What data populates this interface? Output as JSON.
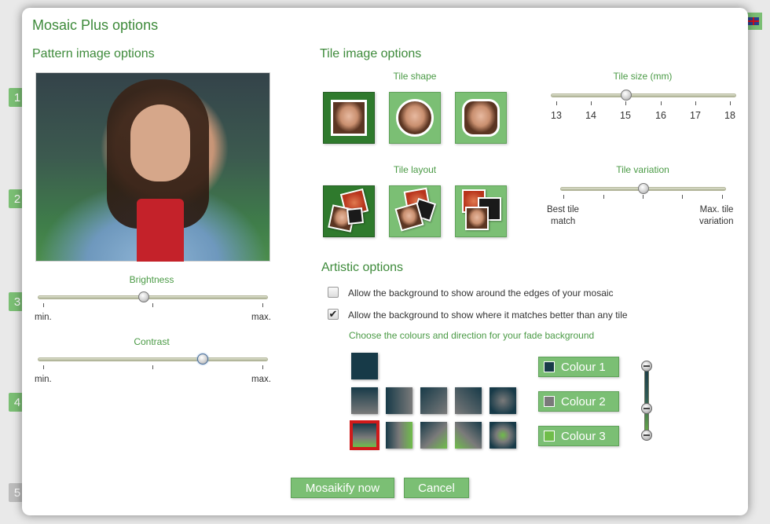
{
  "background": {
    "steps": [
      "1",
      "2",
      "3",
      "4",
      "5"
    ]
  },
  "dialog": {
    "title": "Mosaic Plus options",
    "pattern": {
      "heading": "Pattern image options",
      "brightness": {
        "label": "Brightness",
        "min_label": "min.",
        "max_label": "max.",
        "value": 0.47
      },
      "contrast": {
        "label": "Contrast",
        "min_label": "min.",
        "max_label": "max.",
        "value": 0.72
      }
    },
    "tile": {
      "heading": "Tile image options",
      "shape_label": "Tile shape",
      "shapes": [
        "square",
        "circle",
        "rounded-square"
      ],
      "selected_shape": "square",
      "layout_label": "Tile layout",
      "layouts": [
        "scattered",
        "overlapping",
        "stacked"
      ],
      "selected_layout": "scattered",
      "size_label": "Tile size (mm)",
      "size_ticks": [
        "13",
        "14",
        "15",
        "16",
        "17",
        "18"
      ],
      "size_value": 15,
      "variation_label": "Tile variation",
      "variation_min": "Best tile match",
      "variation_min_line1": "Best tile",
      "variation_min_line2": "match",
      "variation_max_line1": "Max. tile",
      "variation_max_line2": "variation",
      "variation_value": 0.5
    },
    "artistic": {
      "heading": "Artistic options",
      "option1": {
        "label": "Allow the background to show around the edges of your mosaic",
        "checked": false
      },
      "option2": {
        "label": "Allow the background to show where it matches better than any tile",
        "checked": true
      },
      "fade_label": "Choose the colours and direction for your fade background",
      "colour1": {
        "label": "Colour 1",
        "color": "#173a48"
      },
      "colour2": {
        "label": "Colour 2",
        "color": "#7a7a7a"
      },
      "colour3": {
        "label": "Colour 3",
        "color": "#6fbd4a"
      },
      "fade_selected_index": 6
    },
    "buttons": {
      "mosaikify": "Mosaikify now",
      "cancel": "Cancel"
    }
  },
  "colors": {
    "accent": "#7bbf74",
    "accent_dark": "#2f7a2d",
    "title_green": "#3d8a3a"
  }
}
